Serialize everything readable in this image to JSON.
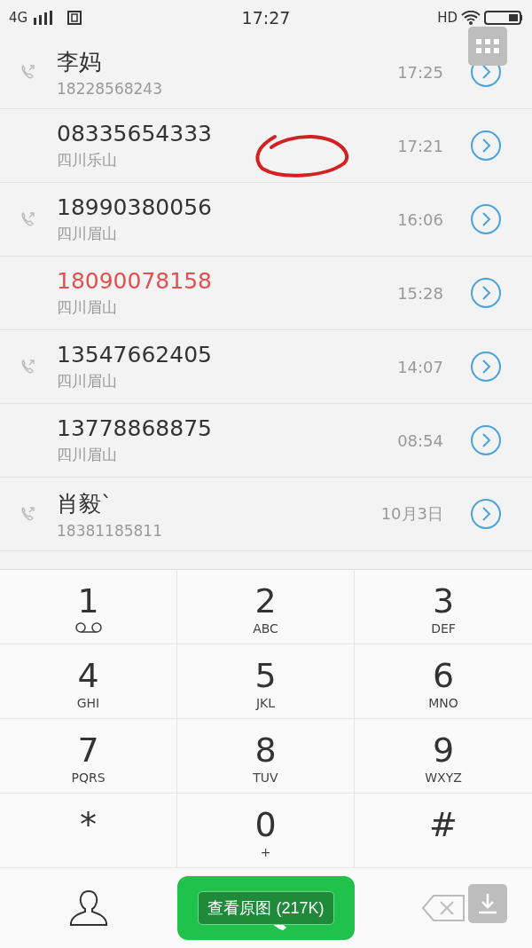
{
  "status_bar": {
    "network": "4G",
    "time": "17:27",
    "hd": "HD"
  },
  "calls": [
    {
      "name": "李妈",
      "detail": "18228568243",
      "time": "17:25",
      "missed": false,
      "call_icon": true
    },
    {
      "name": "08335654333",
      "detail": "四川乐山",
      "time": "17:21",
      "missed": false,
      "call_icon": false
    },
    {
      "name": "18990380056",
      "detail": "四川眉山",
      "time": "16:06",
      "missed": false,
      "call_icon": true
    },
    {
      "name": "18090078158",
      "detail": "四川眉山",
      "time": "15:28",
      "missed": true,
      "call_icon": false
    },
    {
      "name": "13547662405",
      "detail": "四川眉山",
      "time": "14:07",
      "missed": false,
      "call_icon": true
    },
    {
      "name": "13778868875",
      "detail": "四川眉山",
      "time": "08:54",
      "missed": false,
      "call_icon": false
    },
    {
      "name": "肖毅`",
      "detail": "18381185811",
      "time": "10月3日",
      "missed": false,
      "call_icon": true
    }
  ],
  "keypad": [
    {
      "digit": "1",
      "kind": "voicemail"
    },
    {
      "digit": "2",
      "kind": "letters",
      "sub": "ABC"
    },
    {
      "digit": "3",
      "kind": "letters",
      "sub": "DEF"
    },
    {
      "digit": "4",
      "kind": "letters",
      "sub": "GHI"
    },
    {
      "digit": "5",
      "kind": "letters",
      "sub": "JKL"
    },
    {
      "digit": "6",
      "kind": "letters",
      "sub": "MNO"
    },
    {
      "digit": "7",
      "kind": "letters",
      "sub": "PQRS"
    },
    {
      "digit": "8",
      "kind": "letters",
      "sub": "TUV"
    },
    {
      "digit": "9",
      "kind": "letters",
      "sub": "WXYZ"
    },
    {
      "digit": "*",
      "kind": "plain"
    },
    {
      "digit": "0",
      "kind": "letters",
      "sub": "+"
    },
    {
      "digit": "#",
      "kind": "plain"
    }
  ],
  "viewer_overlay": {
    "view_original": "查看原图 (217K)"
  }
}
